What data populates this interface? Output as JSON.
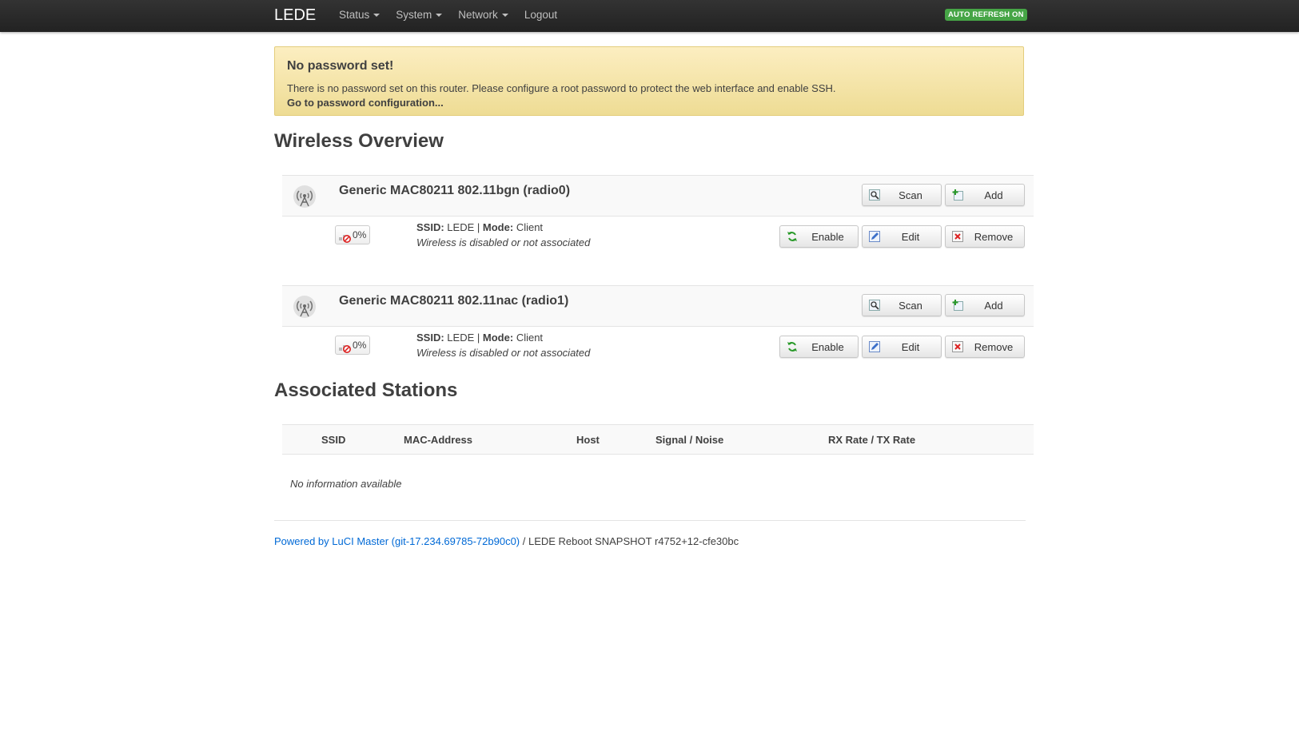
{
  "navbar": {
    "brand": "LEDE",
    "menu": [
      {
        "label": "Status",
        "dropdown": true
      },
      {
        "label": "System",
        "dropdown": true
      },
      {
        "label": "Network",
        "dropdown": true
      },
      {
        "label": "Logout",
        "dropdown": false
      }
    ],
    "autorefresh": "AUTO REFRESH ON"
  },
  "alert": {
    "title": "No password set!",
    "text": "There is no password set on this router. Please configure a root password to protect the web interface and enable SSH.",
    "link": "Go to password configuration..."
  },
  "wireless": {
    "heading": "Wireless Overview",
    "devices": [
      {
        "name": "Generic MAC80211 802.11bgn (radio0)",
        "scan_label": "Scan",
        "add_label": "Add",
        "network": {
          "signal": "0%",
          "ssid_label": "SSID:",
          "ssid": "LEDE",
          "separator": "|",
          "mode_label": "Mode:",
          "mode": "Client",
          "status": "Wireless is disabled or not associated",
          "enable_label": "Enable",
          "edit_label": "Edit",
          "remove_label": "Remove"
        }
      },
      {
        "name": "Generic MAC80211 802.11nac (radio1)",
        "scan_label": "Scan",
        "add_label": "Add",
        "network": {
          "signal": "0%",
          "ssid_label": "SSID:",
          "ssid": "LEDE",
          "separator": "|",
          "mode_label": "Mode:",
          "mode": "Client",
          "status": "Wireless is disabled or not associated",
          "enable_label": "Enable",
          "edit_label": "Edit",
          "remove_label": "Remove"
        }
      }
    ]
  },
  "stations": {
    "heading": "Associated Stations",
    "columns": [
      "SSID",
      "MAC-Address",
      "Host",
      "Signal / Noise",
      "RX Rate / TX Rate"
    ],
    "empty": "No information available"
  },
  "footer": {
    "link": "Powered by LuCI Master (git-17.234.69785-72b90c0)",
    "rest": " / LEDE Reboot SNAPSHOT r4752+12-cfe30bc"
  },
  "colors": {
    "navbar": "#222222",
    "alert_bg": "#fceec1",
    "badge": "#46a546",
    "link": "#0069d6"
  }
}
